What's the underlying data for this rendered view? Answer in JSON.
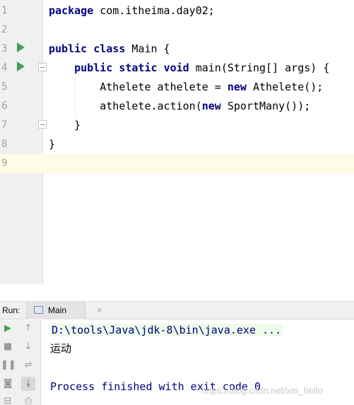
{
  "editor": {
    "lines": [
      {
        "number": "1",
        "tokens": [
          {
            "text": "package",
            "kw": true
          },
          {
            "text": " com.itheima.day02;",
            "kw": false
          }
        ]
      },
      {
        "number": "2",
        "tokens": []
      },
      {
        "number": "3",
        "tokens": [
          {
            "text": "public",
            "kw": true
          },
          {
            "text": " ",
            "kw": false
          },
          {
            "text": "class",
            "kw": true
          },
          {
            "text": " Main {",
            "kw": false
          }
        ]
      },
      {
        "number": "4",
        "tokens": [
          {
            "text": "    ",
            "kw": false
          },
          {
            "text": "public",
            "kw": true
          },
          {
            "text": " ",
            "kw": false
          },
          {
            "text": "static",
            "kw": true
          },
          {
            "text": " ",
            "kw": false
          },
          {
            "text": "void",
            "kw": true
          },
          {
            "text": " main(String[] args) {",
            "kw": false
          }
        ]
      },
      {
        "number": "5",
        "tokens": [
          {
            "text": "        Athelete athelete = ",
            "kw": false
          },
          {
            "text": "new",
            "kw": true
          },
          {
            "text": " Athelete();",
            "kw": false
          }
        ]
      },
      {
        "number": "6",
        "tokens": [
          {
            "text": "        athelete.action(",
            "kw": false
          },
          {
            "text": "new",
            "kw": true
          },
          {
            "text": " SportMany());",
            "kw": false
          }
        ]
      },
      {
        "number": "7",
        "tokens": [
          {
            "text": "    }",
            "kw": false
          }
        ]
      },
      {
        "number": "8",
        "tokens": [
          {
            "text": "}",
            "kw": false
          }
        ]
      },
      {
        "number": "9",
        "tokens": []
      }
    ],
    "current_line": "9"
  },
  "run": {
    "label": "Run:",
    "tab_label": "Main",
    "tab_close": "×",
    "console": {
      "command": "D:\\tools\\Java\\jdk-8\\bin\\java.exe ...",
      "output": "运动",
      "finished": "Process finished with exit code 0"
    },
    "toolbar": [
      {
        "name": "rerun-icon",
        "glyph": "▶"
      },
      {
        "name": "up-arrow-icon",
        "glyph": "↑"
      },
      {
        "name": "stop-icon",
        "glyph": "■"
      },
      {
        "name": "down-arrow-icon",
        "glyph": "↓"
      },
      {
        "name": "pause-icon",
        "glyph": "❚❚"
      },
      {
        "name": "soft-wrap-icon",
        "glyph": "⇌"
      },
      {
        "name": "camera-icon",
        "glyph": "◙"
      },
      {
        "name": "scroll-to-end-icon",
        "glyph": "⤓"
      },
      {
        "name": "restore-layout-icon",
        "glyph": "⊟"
      },
      {
        "name": "print-icon",
        "glyph": "⎙"
      }
    ]
  },
  "watermark": "https://blog.csdn.net/xm_hello",
  "colors": {
    "keyword": "#000080",
    "run_green": "#499c54",
    "current_line_bg": "#fefbe6"
  }
}
